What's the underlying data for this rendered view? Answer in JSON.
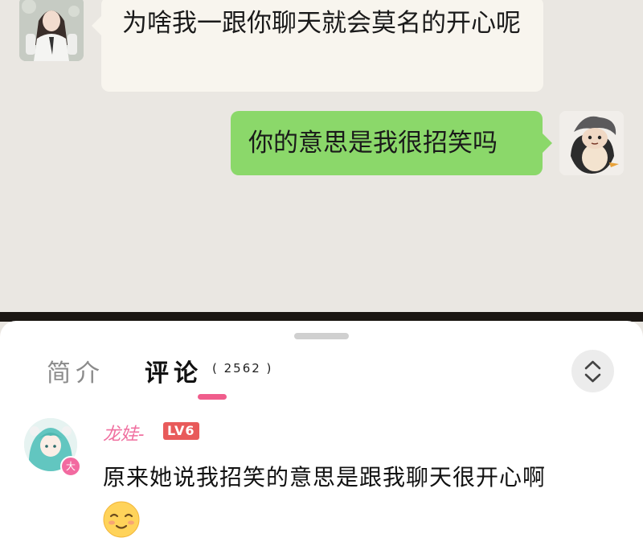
{
  "chat": {
    "received_message": "为啥我一跟你聊天就会莫名的开心呢",
    "sent_message": "你的意思是我很招笑吗"
  },
  "comments_panel": {
    "tabs": [
      {
        "label": "简介"
      },
      {
        "label": "评论"
      }
    ],
    "comment_count": "( 2562 )",
    "comment": {
      "username": "龙娃-",
      "level": "LV6",
      "avatar_badge": "大",
      "text": "原来她说我招笑的意思是跟我聊天很开心啊",
      "emoji_icon": "smile-emoji-icon"
    }
  },
  "colors": {
    "sent_bubble": "#8bd86a",
    "received_bubble": "#f8f5ee",
    "accent_pink": "#f05d8c",
    "level_badge": "#e85a5a"
  }
}
